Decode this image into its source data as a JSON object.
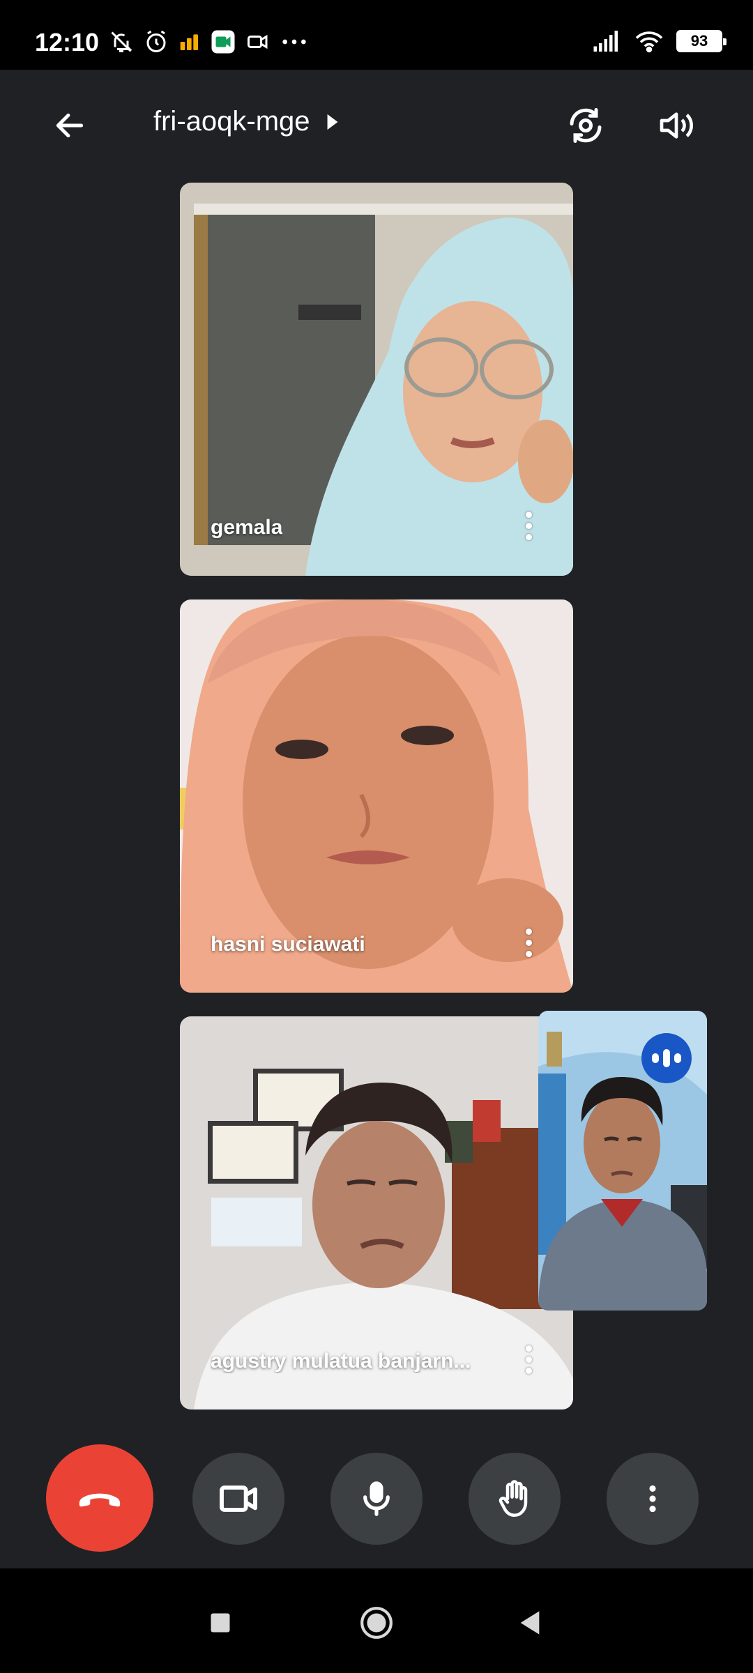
{
  "status_bar": {
    "time": "12:10",
    "battery": "93",
    "left_icons": [
      "mute-icon",
      "alarm-icon",
      "data-icon",
      "meet-app-icon",
      "camera-icon",
      "more-notifications-icon"
    ],
    "right_icons": [
      "signal-icon",
      "wifi-icon",
      "battery-icon"
    ]
  },
  "header": {
    "meeting_code": "fri-aoqk-mge"
  },
  "participants": [
    {
      "name": "gemala"
    },
    {
      "name": "hasni suciawati"
    },
    {
      "name": "agustry mulatua banjarn..."
    }
  ],
  "self_view": {
    "speaking_indicator": "speaking-indicator-icon"
  },
  "controls": {
    "end_call_color": "#ea4335",
    "button_color": "#3c4043",
    "speaking_badge_color": "#1a57c6"
  }
}
